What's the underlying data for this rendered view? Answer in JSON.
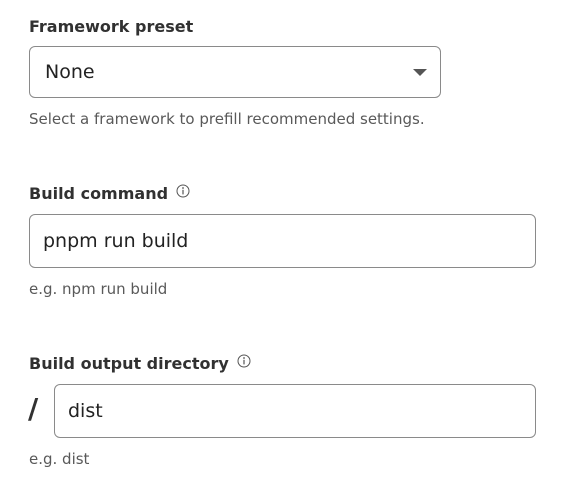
{
  "framework": {
    "label": "Framework preset",
    "selected": "None",
    "help": "Select a framework to prefill recommended settings."
  },
  "build_command": {
    "label": "Build command",
    "value": "pnpm run build",
    "help": "e.g. npm run build",
    "icon": "info-icon"
  },
  "output_dir": {
    "label": "Build output directory",
    "prefix": "/",
    "value": "dist",
    "help": "e.g. dist",
    "icon": "info-icon"
  }
}
